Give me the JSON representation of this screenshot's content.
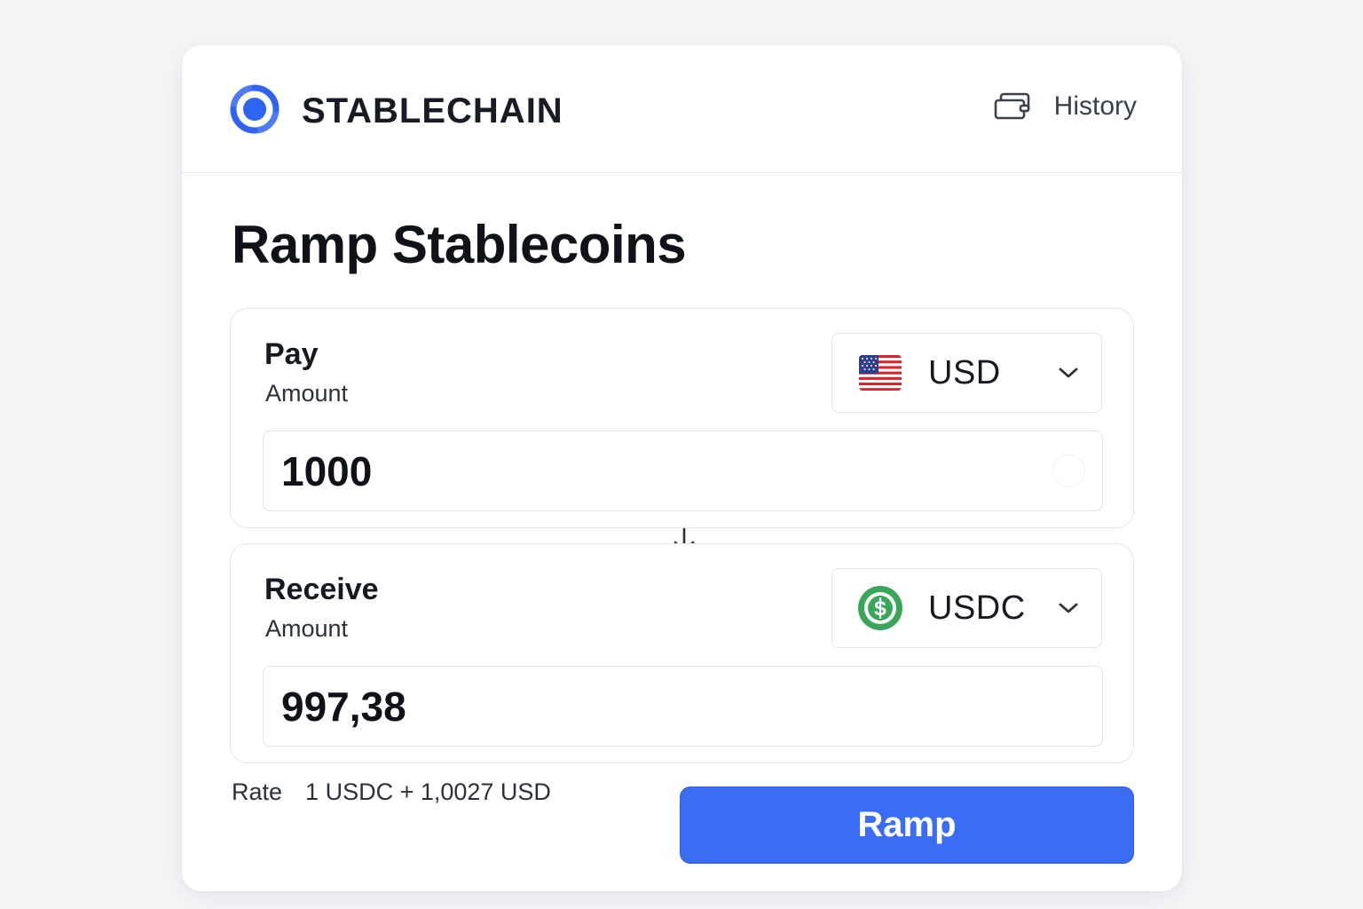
{
  "header": {
    "brand": "STABLECHAIN",
    "history_label": "History",
    "logo_icon": "stablechain-logo-icon",
    "history_icon": "wallet-icon"
  },
  "main": {
    "title": "Ramp Stablecoins",
    "pay": {
      "title": "Pay",
      "subtitle": "Amount",
      "currency": "USD",
      "currency_icon": "us-flag-icon",
      "amount": "1000"
    },
    "receive": {
      "title": "Receive",
      "subtitle": "Amount",
      "currency": "USDC",
      "currency_icon": "usdc-coin-icon",
      "amount": "997,38"
    },
    "rate_label": "Rate",
    "rate_value": "1 USDC + 1,0027 USD",
    "ramp_label": "Ramp"
  },
  "colors": {
    "accent": "#3b6cf6",
    "logo_blue": "#2f63f2",
    "usdc_green": "#3aa65a"
  }
}
